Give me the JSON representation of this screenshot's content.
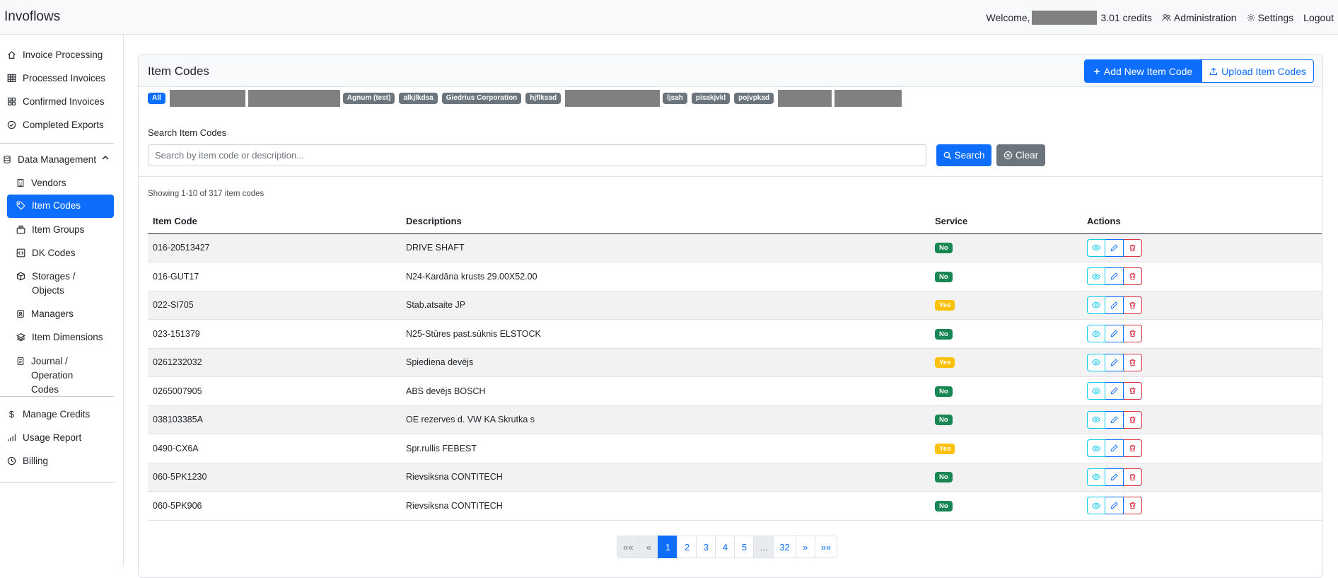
{
  "app": {
    "brand": "Invoflows"
  },
  "topbar": {
    "welcome": "Welcome,",
    "credits": "3.01 credits",
    "administration": "Administration",
    "settings": "Settings",
    "logout": "Logout"
  },
  "sidebar": {
    "invoice_processing": "Invoice Processing",
    "processed_invoices": "Processed Invoices",
    "confirmed_invoices": "Confirmed Invoices",
    "completed_exports": "Completed Exports",
    "data_management": "Data Management",
    "vendors": "Vendors",
    "item_codes": "Item Codes",
    "item_groups": "Item Groups",
    "dk_codes": "DK Codes",
    "storages": "Storages / Objects",
    "managers": "Managers",
    "item_dimensions": "Item Dimensions",
    "journal": "Journal / Operation Codes",
    "manage_credits": "Manage Credits",
    "usage_report": "Usage Report",
    "billing": "Billing"
  },
  "card": {
    "title": "Item Codes",
    "add_button": "Add New Item Code",
    "upload_button": "Upload Item Codes"
  },
  "filters": {
    "all": "All",
    "agnum": "Agnum (test)",
    "alkjlkdsa": "alkjlkdsa",
    "giedrius": "Giedrius Corporation",
    "hjflksad": "hjflksad",
    "ljsah": "ljsah",
    "pisakjvkl": "pisakjvkl",
    "pojvpkad": "pojvpkad"
  },
  "search": {
    "label": "Search Item Codes",
    "placeholder": "Search by item code or description...",
    "search_button": "Search",
    "clear_button": "Clear"
  },
  "showing": "Showing 1-10 of 317 item codes",
  "table": {
    "headers": {
      "code": "Item Code",
      "desc": "Descriptions",
      "service": "Service",
      "actions": "Actions"
    },
    "rows": [
      {
        "code": "016-20513427",
        "desc": "DRIVE SHAFT",
        "service": "No"
      },
      {
        "code": "016-GUT17",
        "desc": "N24-Kardāna krusts 29.00X52.00",
        "service": "No"
      },
      {
        "code": "022-SI705",
        "desc": "Stab.atsaite JP",
        "service": "Yes"
      },
      {
        "code": "023-151379",
        "desc": "N25-Stūres past.sūknis ELSTOCK",
        "service": "No"
      },
      {
        "code": "0261232032",
        "desc": "Spiediena devējs",
        "service": "Yes"
      },
      {
        "code": "0265007905",
        "desc": "ABS devējs BOSCH",
        "service": "No"
      },
      {
        "code": "038103385A",
        "desc": "OE rezerves d. VW KA Skrutka s",
        "service": "No"
      },
      {
        "code": "0490-CX6A",
        "desc": "Spr.rullis FEBEST",
        "service": "Yes"
      },
      {
        "code": "060-5PK1230",
        "desc": "Rievsiksna CONTITECH",
        "service": "No"
      },
      {
        "code": "060-5PK906",
        "desc": "Rievsiksna CONTITECH",
        "service": "No"
      }
    ]
  },
  "pagination": {
    "first": "««",
    "prev": "«",
    "p1": "1",
    "p2": "2",
    "p3": "3",
    "p4": "4",
    "p5": "5",
    "ellipsis": "...",
    "p32": "32",
    "next": "»",
    "last": "»»"
  },
  "colors": {
    "primary": "#0d6efd",
    "success": "#198754",
    "warning": "#ffc107",
    "danger": "#dc3545",
    "info": "#0dcaf0",
    "secondary": "#6c757d"
  }
}
